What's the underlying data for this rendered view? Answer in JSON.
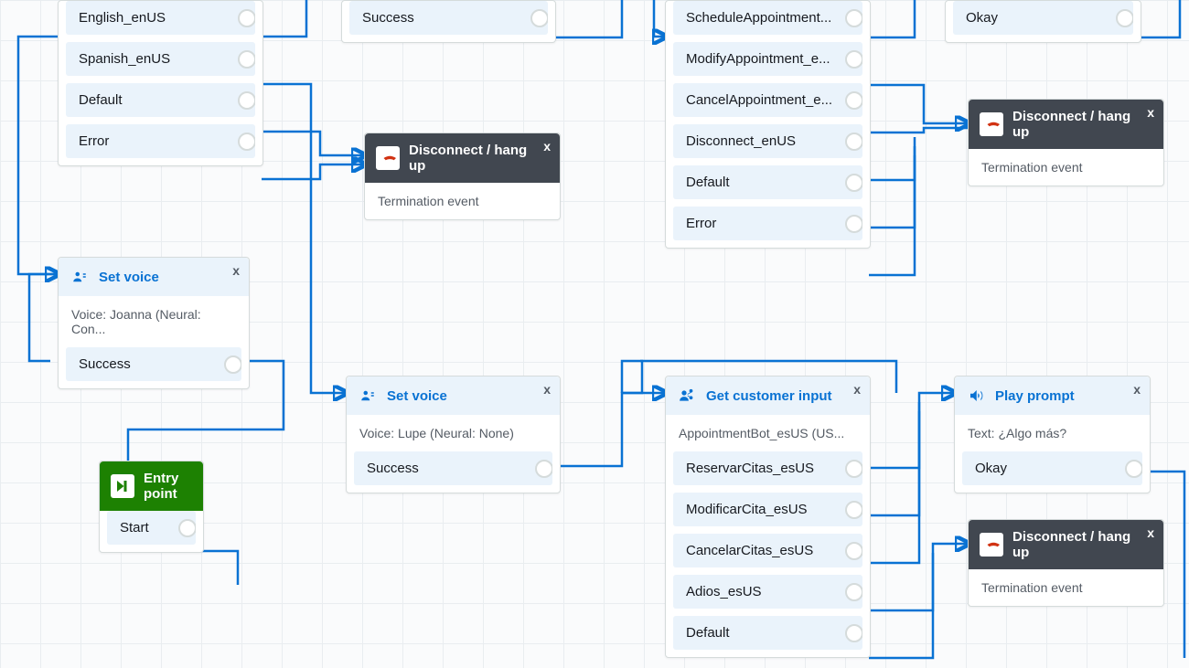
{
  "lang": {
    "branches": [
      "English_enUS",
      "Spanish_enUS",
      "Default",
      "Error"
    ]
  },
  "successTop": {
    "branch": "Success"
  },
  "getCustomerEn": {
    "branches": [
      "ScheduleAppointment...",
      "ModifyAppointment_e...",
      "CancelAppointment_e...",
      "Disconnect_enUS",
      "Default",
      "Error"
    ]
  },
  "okayTop": {
    "branch": "Okay"
  },
  "disconnect": {
    "title": "Disconnect / hang up",
    "body": "Termination event"
  },
  "setVoiceEn": {
    "title": "Set voice",
    "body": "Voice: Joanna (Neural: Con...",
    "branch": "Success"
  },
  "setVoiceEs": {
    "title": "Set voice",
    "body": "Voice: Lupe (Neural: None)",
    "branch": "Success"
  },
  "entry": {
    "title": "Entry point",
    "branch": "Start"
  },
  "getCustomerEs": {
    "title": "Get customer input",
    "body": "AppointmentBot_esUS (US...",
    "branches": [
      "ReservarCitas_esUS",
      "ModificarCita_esUS",
      "CancelarCitas_esUS",
      "Adios_esUS",
      "Default"
    ]
  },
  "playPrompt": {
    "title": "Play prompt",
    "body": "Text: ¿Algo más?",
    "branch": "Okay"
  },
  "close": "x"
}
